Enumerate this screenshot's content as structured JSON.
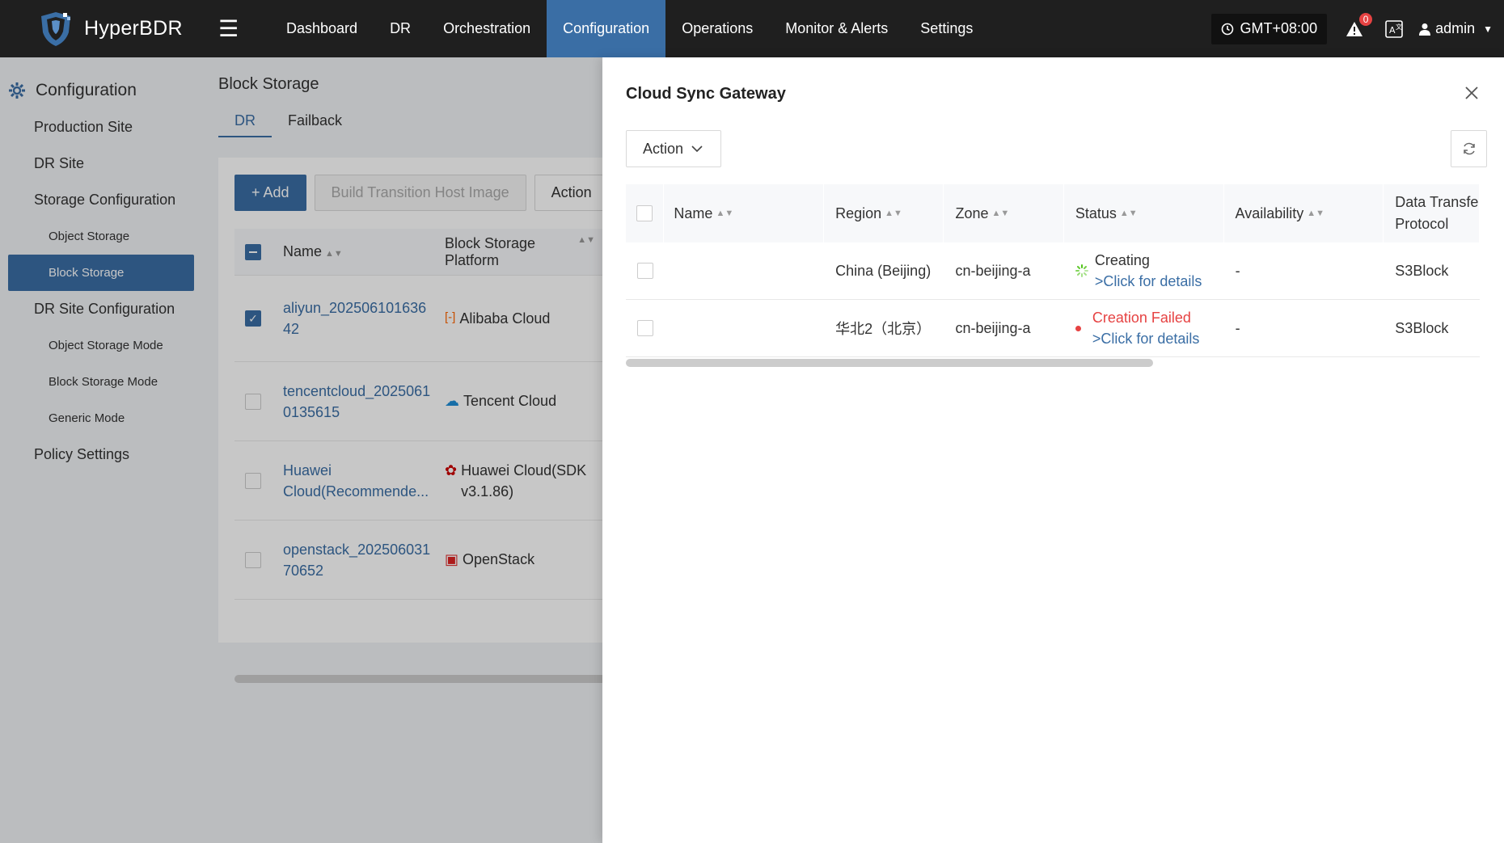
{
  "app": {
    "name": "HyperBDR"
  },
  "nav": {
    "items": [
      {
        "label": "Dashboard",
        "active": false
      },
      {
        "label": "DR",
        "active": false
      },
      {
        "label": "Orchestration",
        "active": false
      },
      {
        "label": "Configuration",
        "active": true
      },
      {
        "label": "Operations",
        "active": false
      },
      {
        "label": "Monitor & Alerts",
        "active": false
      },
      {
        "label": "Settings",
        "active": false
      }
    ],
    "timezone": "GMT+08:00",
    "alert_count": "0",
    "user": "admin"
  },
  "sidebar": {
    "title": "Configuration",
    "items": {
      "production_site": "Production Site",
      "dr_site": "DR Site",
      "storage_configuration": "Storage Configuration",
      "object_storage": "Object Storage",
      "block_storage": "Block Storage",
      "dr_site_configuration": "DR Site Configuration",
      "object_storage_mode": "Object Storage Mode",
      "block_storage_mode": "Block Storage Mode",
      "generic_mode": "Generic Mode",
      "policy_settings": "Policy Settings"
    }
  },
  "main": {
    "title": "Block Storage",
    "tabs": {
      "dr": "DR",
      "failback": "Failback"
    },
    "toolbar": {
      "add": "+ Add",
      "build": "Build Transition Host Image",
      "action": "Action"
    },
    "columns": {
      "name": "Name",
      "platform": "Block Storage Platform"
    },
    "rows": [
      {
        "name": "aliyun_20250610163642",
        "platform": "Alibaba Cloud",
        "checked": true
      },
      {
        "name": "tencentcloud_20250610135615",
        "platform": "Tencent Cloud",
        "checked": false
      },
      {
        "name": "Huawei Cloud(Recommende...",
        "platform": "Huawei Cloud(SDK v3.1.86)",
        "checked": false
      },
      {
        "name": "openstack_20250603170652",
        "platform": "OpenStack",
        "checked": false
      }
    ]
  },
  "drawer": {
    "title": "Cloud Sync Gateway",
    "action_label": "Action",
    "columns": {
      "name": "Name",
      "region": "Region",
      "zone": "Zone",
      "status": "Status",
      "availability": "Availability",
      "protocol_line1": "Data Transfe",
      "protocol_line2": "Protocol"
    },
    "rows": [
      {
        "name": "",
        "region": "China (Beijing)",
        "zone": "cn-beijing-a",
        "status": "Creating",
        "details": ">Click for details",
        "availability": "-",
        "protocol": "S3Block"
      },
      {
        "name": "",
        "region": "华北2（北京）",
        "zone": "cn-beijing-a",
        "status": "Creation Failed",
        "details": ">Click for details",
        "availability": "-",
        "protocol": "S3Block"
      }
    ],
    "colors": {
      "accent": "#3a6ea5",
      "error": "#e64242",
      "creating": "#52c41a"
    }
  }
}
